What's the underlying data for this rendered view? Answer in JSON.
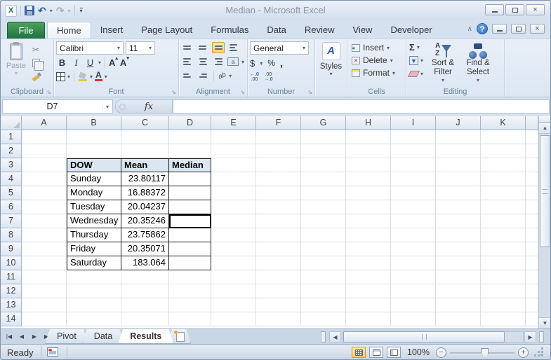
{
  "window": {
    "title": "Median  -  Microsoft Excel"
  },
  "icons": {
    "dropdown": "▾",
    "undo": "↶",
    "redo": "↷",
    "cut": "✂",
    "collapse": "∧",
    "help": "?",
    "close": "×",
    "up_arrow": "▲",
    "down_arrow": "▼",
    "nav_first": "|◀",
    "nav_prev": "◀",
    "nav_next": "▶",
    "nav_last": "▶|",
    "scroll_left": "◀",
    "scroll_right": "▶",
    "grow_mark": "▴",
    "shrink_mark": "▾"
  },
  "ribbon_tabs": {
    "file": "File",
    "tabs": [
      "Home",
      "Insert",
      "Page Layout",
      "Formulas",
      "Data",
      "Review",
      "View",
      "Developer"
    ],
    "active": "Home"
  },
  "ribbon": {
    "clipboard": {
      "label": "Clipboard",
      "paste": "Paste"
    },
    "font": {
      "label": "Font",
      "font_name": "Calibri",
      "font_size": "11",
      "bold": "B",
      "italic": "I",
      "underline": "U",
      "grow": "A",
      "shrink": "A"
    },
    "alignment": {
      "label": "Alignment",
      "orientation": "ab"
    },
    "number": {
      "label": "Number",
      "format": "General",
      "currency": "$",
      "percent": "%",
      "comma": ",",
      "inc_top": "←.0",
      "inc_bot": ".00",
      "dec_top": ".00",
      "dec_bot": "→.0"
    },
    "styles": {
      "button": "Styles",
      "icon_letter": "A"
    },
    "cells": {
      "label": "Cells",
      "insert": "Insert",
      "delete": "Delete",
      "format": "Format"
    },
    "editing": {
      "label": "Editing",
      "sum": "Σ",
      "sort_a": "A",
      "sort_z": "Z",
      "sort_filter": "Sort & Filter",
      "find_select": "Find & Select"
    }
  },
  "formula_bar": {
    "name_box": "D7",
    "fx": "fx",
    "value": ""
  },
  "grid": {
    "columns": [
      "A",
      "B",
      "C",
      "D",
      "E",
      "F",
      "G",
      "H",
      "I",
      "J",
      "K"
    ],
    "row_numbers": [
      "1",
      "2",
      "3",
      "4",
      "5",
      "6",
      "7",
      "8",
      "9",
      "10",
      "11",
      "12",
      "13",
      "14"
    ],
    "selected_cell": "D7",
    "table": {
      "origin_col": "B",
      "origin_row": 3,
      "headers": [
        "DOW",
        "Mean",
        "Median"
      ],
      "col_aligns": [
        "left",
        "right",
        "left"
      ],
      "rows": [
        [
          "Sunday",
          "23.80117",
          ""
        ],
        [
          "Monday",
          "16.88372",
          ""
        ],
        [
          "Tuesday",
          "20.04237",
          ""
        ],
        [
          "Wednesday",
          "20.35246",
          ""
        ],
        [
          "Thursday",
          "23.75862",
          ""
        ],
        [
          "Friday",
          "20.35071",
          ""
        ],
        [
          "Saturday",
          "183.064",
          ""
        ]
      ]
    }
  },
  "sheet_tabs": {
    "tabs": [
      {
        "label": "Pivot",
        "active": false
      },
      {
        "label": "Data",
        "active": false
      },
      {
        "label": "Results",
        "active": true
      }
    ]
  },
  "status_bar": {
    "mode": "Ready",
    "zoom_level": "100%"
  },
  "colors": {
    "table_header_bg": "#dce6f1",
    "file_button": "#1e7144",
    "selection_border": "#000000"
  }
}
